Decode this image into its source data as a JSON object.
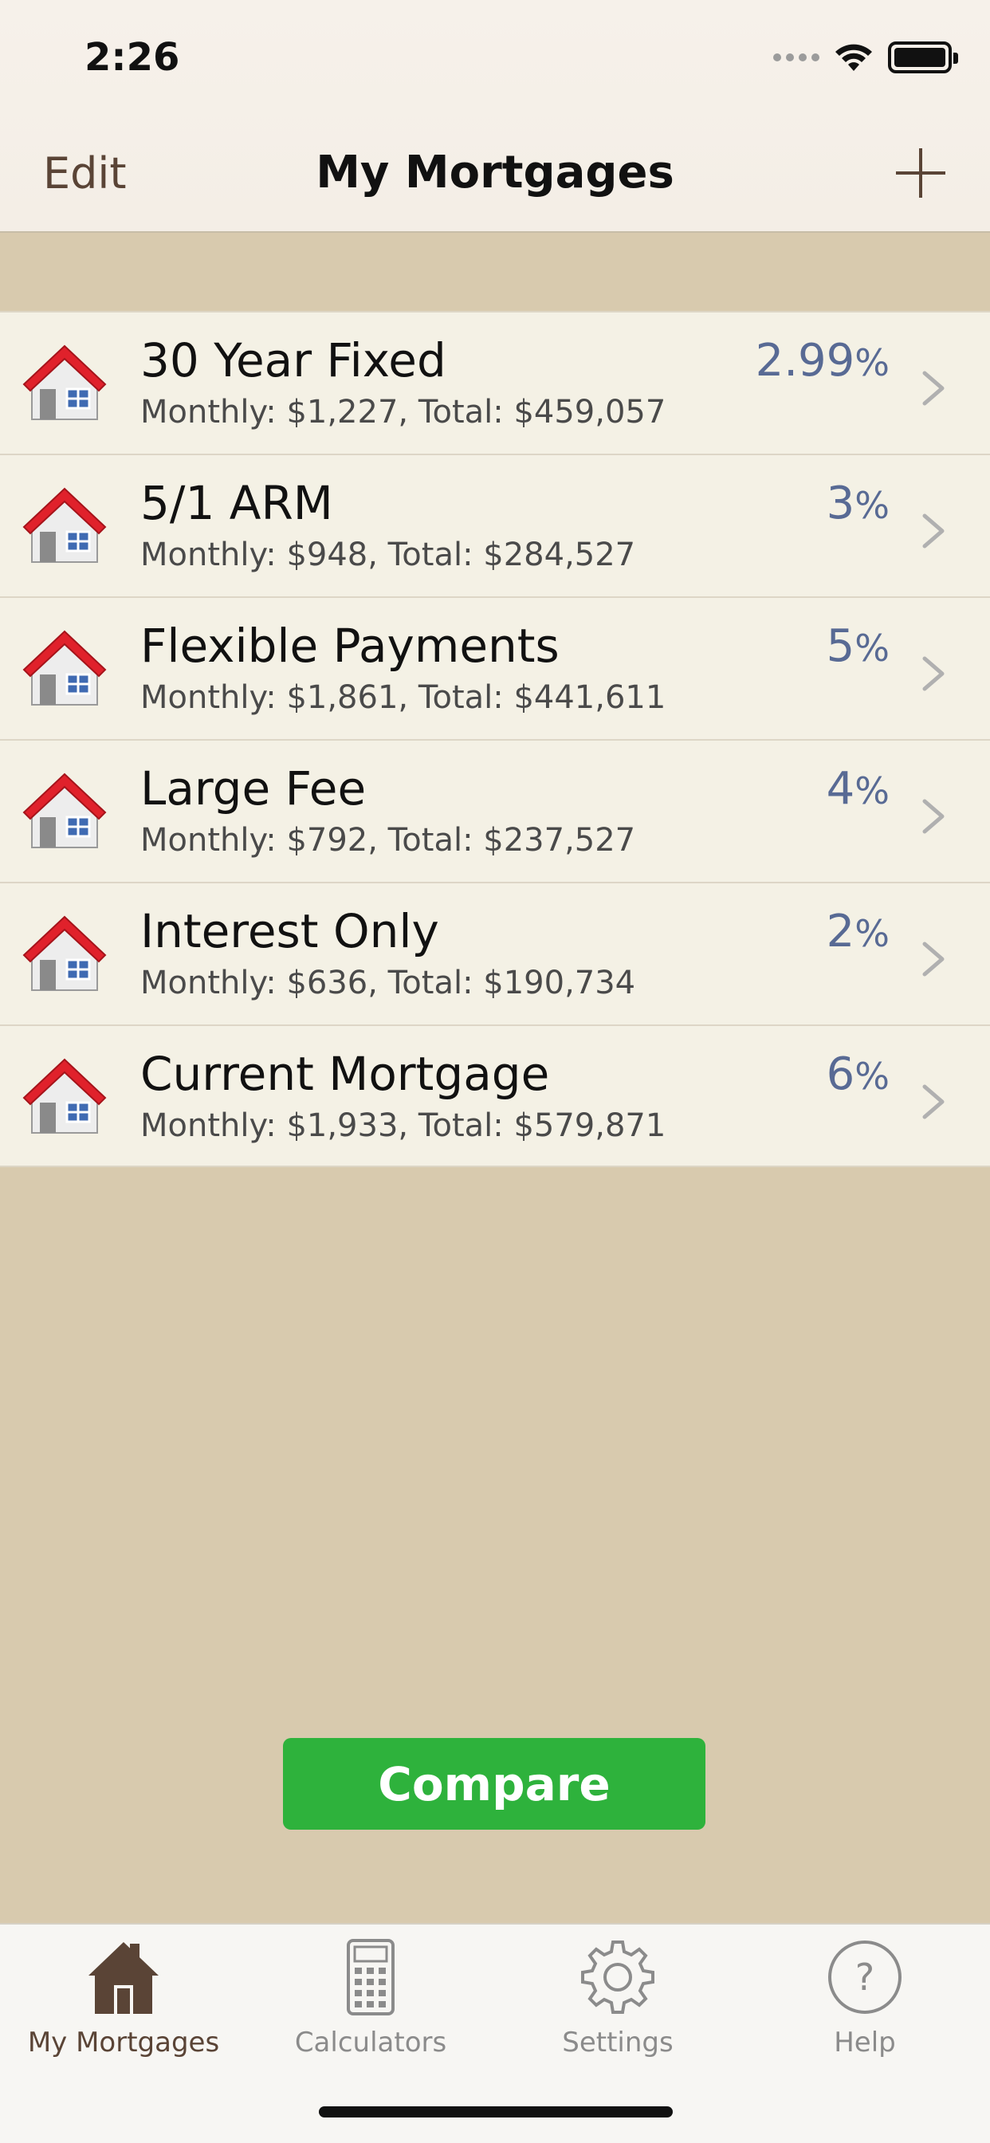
{
  "status": {
    "time": "2:26"
  },
  "nav": {
    "edit_label": "Edit",
    "title": "My Mortgages"
  },
  "mortgages": [
    {
      "name": "30 Year Fixed",
      "subtitle": "Monthly: $1,227, Total: $459,057",
      "rate": "2.99",
      "pct": "%"
    },
    {
      "name": "5/1 ARM",
      "subtitle": "Monthly: $948, Total: $284,527",
      "rate": "3",
      "pct": "%"
    },
    {
      "name": "Flexible Payments",
      "subtitle": "Monthly: $1,861, Total: $441,611",
      "rate": "5",
      "pct": "%"
    },
    {
      "name": "Large Fee",
      "subtitle": "Monthly: $792, Total: $237,527",
      "rate": "4",
      "pct": "%"
    },
    {
      "name": "Interest Only",
      "subtitle": "Monthly: $636, Total: $190,734",
      "rate": "2",
      "pct": "%"
    },
    {
      "name": "Current Mortgage",
      "subtitle": "Monthly: $1,933, Total: $579,871",
      "rate": "6",
      "pct": "%"
    }
  ],
  "compare_label": "Compare",
  "tabs": [
    {
      "label": "My Mortgages",
      "icon": "house-icon",
      "active": true
    },
    {
      "label": "Calculators",
      "icon": "calculator-icon",
      "active": false
    },
    {
      "label": "Settings",
      "icon": "gear-icon",
      "active": false
    },
    {
      "label": "Help",
      "icon": "question-icon",
      "active": false
    }
  ],
  "colors": {
    "accent_green": "#2eb23c",
    "rate_blue": "#586a94",
    "brown": "#5a4436"
  }
}
